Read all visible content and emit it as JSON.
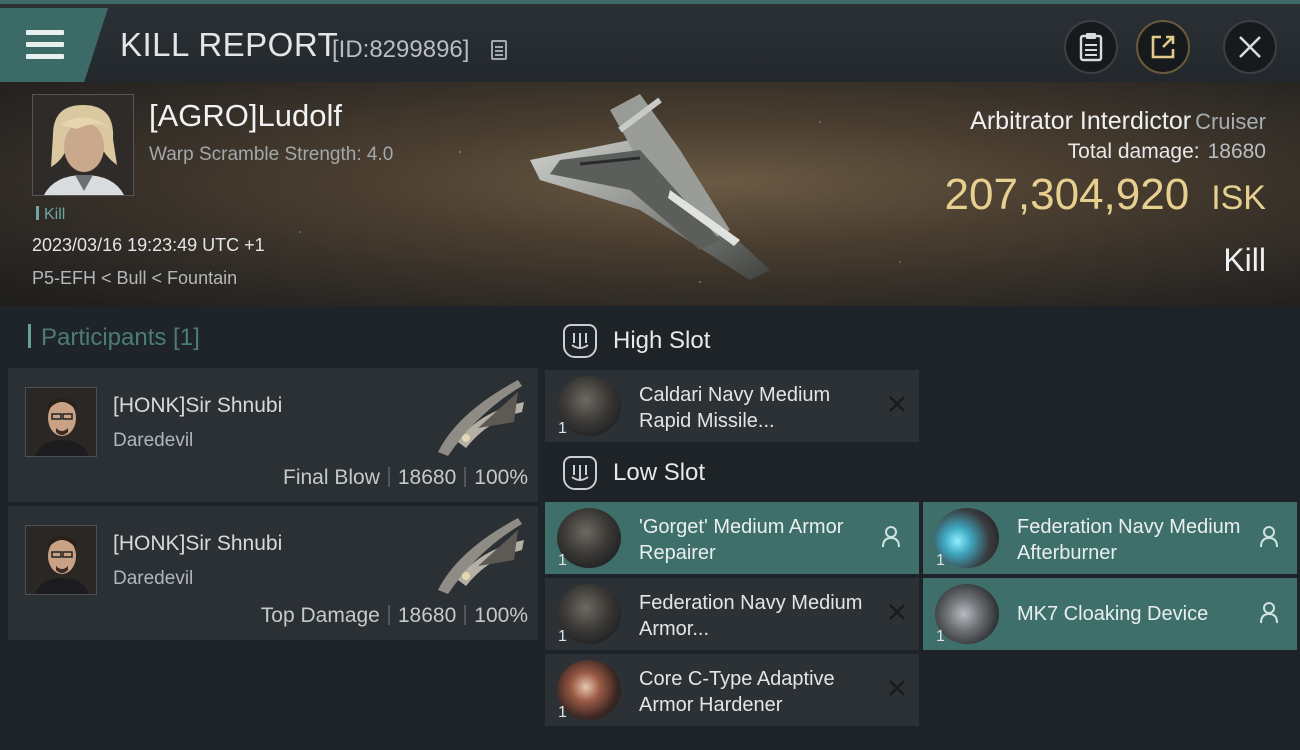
{
  "header": {
    "title": "KILL REPORT",
    "report_id": "[ID:8299896]",
    "icons": [
      "menu-icon",
      "copy-icon",
      "clipboard-icon",
      "share-icon",
      "close-icon"
    ]
  },
  "victim": {
    "name": "[AGRO]Ludolf",
    "warp_scramble": "Warp Scramble Strength: 4.0",
    "tag": "Kill",
    "datetime": "2023/03/16 19:23:49 UTC +1",
    "location": "P5-EFH < Bull < Fountain",
    "ship_name": "Arbitrator Interdictor",
    "ship_class": "Cruiser",
    "total_damage_label": "Total damage:",
    "total_damage_value": "18680",
    "isk_value": "207,304,920",
    "isk_unit": "ISK",
    "kill_type": "Kill"
  },
  "participants": {
    "header": "Participants [1]",
    "rows": [
      {
        "name": "[HONK]Sir Shnubi",
        "ship": "Daredevil",
        "role": "Final Blow",
        "damage": "18680",
        "percent": "100%"
      },
      {
        "name": "[HONK]Sir Shnubi",
        "ship": "Daredevil",
        "role": "Top Damage",
        "damage": "18680",
        "percent": "100%"
      }
    ]
  },
  "fitting": {
    "high_slot": {
      "title": "High Slot",
      "modules": [
        {
          "name": "Caldari Navy Medium Rapid Missile...",
          "qty": "1",
          "state": "destroyed"
        }
      ]
    },
    "low_slot": {
      "title": "Low Slot",
      "modules": [
        {
          "name": "'Gorget' Medium Armor Repairer",
          "qty": "1",
          "state": "dropped"
        },
        {
          "name": "Federation Navy Medium Afterburner",
          "qty": "1",
          "state": "dropped"
        },
        {
          "name": "Federation Navy Medium Armor...",
          "qty": "1",
          "state": "destroyed"
        },
        {
          "name": "MK7 Cloaking Device",
          "qty": "1",
          "state": "dropped"
        },
        {
          "name": "Core C-Type Adaptive Armor Hardener",
          "qty": "1",
          "state": "destroyed"
        }
      ]
    }
  },
  "colors": {
    "accent_teal": "#3f6f6b",
    "isk_gold": "#e7cf8f",
    "panel_dark": "#2c3136"
  }
}
